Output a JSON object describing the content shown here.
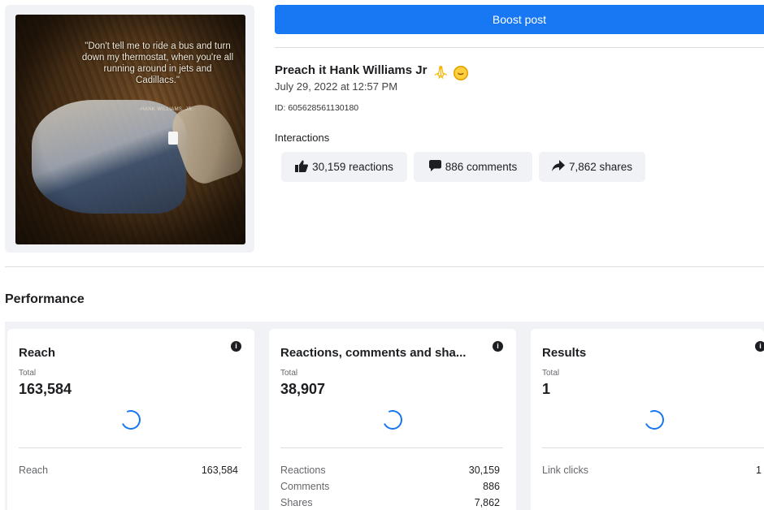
{
  "post": {
    "image_quote": "\"Don't tell me to ride a bus and turn down my thermostat, when you're all running around in jets and Cadillacs.\"",
    "image_attribution": "-HANK WILLIAMS, JR.",
    "boost_label": "Boost post",
    "title": "Preach it Hank Williams Jr",
    "date": "July 29, 2022 at 12:57 PM",
    "id_text": "ID: 605628561130180",
    "interactions_label": "Interactions",
    "chips": {
      "reactions": "30,159 reactions",
      "comments": "886 comments",
      "shares": "7,862 shares"
    }
  },
  "performance": {
    "title": "Performance",
    "cards": [
      {
        "title": "Reach",
        "total_label": "Total",
        "total": "163,584",
        "rows": [
          {
            "label": "Reach",
            "value": "163,584"
          }
        ]
      },
      {
        "title": "Reactions, comments and sha...",
        "total_label": "Total",
        "total": "38,907",
        "rows": [
          {
            "label": "Reactions",
            "value": "30,159"
          },
          {
            "label": "Comments",
            "value": "886"
          },
          {
            "label": "Shares",
            "value": "7,862"
          }
        ]
      },
      {
        "title": "Results",
        "total_label": "Total",
        "total": "1",
        "rows": [
          {
            "label": "Link clicks",
            "value": "1"
          }
        ]
      }
    ]
  },
  "colors": {
    "accent": "#1877f2",
    "chip_bg": "#f0f2f5",
    "divider": "#dadde1"
  },
  "icons": {
    "reactions": "thumbs-up-icon",
    "comments": "comment-bubble-icon",
    "shares": "share-arrow-icon",
    "info": "info-icon",
    "loading": "loading-spinner-icon"
  }
}
